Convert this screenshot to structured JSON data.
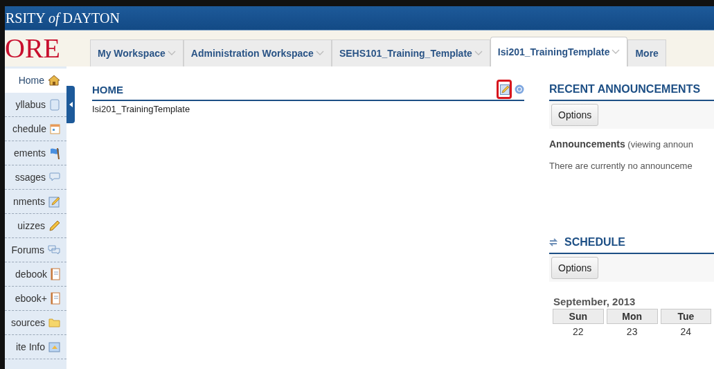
{
  "header": {
    "title": "RSITY *of* DAYTON",
    "logo": "ORE"
  },
  "tabs": [
    {
      "label": "My Workspace",
      "selected": false,
      "menu": true
    },
    {
      "label": "Administration Workspace",
      "selected": false,
      "menu": true
    },
    {
      "label": "SEHS101_Training_Template",
      "selected": false,
      "menu": true
    },
    {
      "label": "Isi201_TrainingTemplate",
      "selected": true,
      "menu": true
    },
    {
      "label": "More",
      "selected": false,
      "menu": false
    }
  ],
  "sidebar": {
    "items": [
      {
        "label": "Home",
        "kind": "home",
        "selected": true
      },
      {
        "label": "yllabus",
        "kind": "scroll",
        "selected": false
      },
      {
        "label": "chedule",
        "kind": "calendar",
        "selected": false
      },
      {
        "label": "ements",
        "kind": "flag",
        "selected": false
      },
      {
        "label": "ssages",
        "kind": "bubble",
        "selected": false
      },
      {
        "label": "nments",
        "kind": "edit",
        "selected": false
      },
      {
        "label": "uizzes",
        "kind": "pencil",
        "selected": false
      },
      {
        "label": "Forums",
        "kind": "bubbles",
        "selected": false
      },
      {
        "label": "debook",
        "kind": "notebook",
        "selected": false
      },
      {
        "label": "ebook+",
        "kind": "notebook",
        "selected": false
      },
      {
        "label": "sources",
        "kind": "folder",
        "selected": false
      },
      {
        "label": "ite Info",
        "kind": "info",
        "selected": false
      }
    ]
  },
  "home": {
    "title": "HOME",
    "site_name": "Isi201_TrainingTemplate",
    "edit_highlighted": true
  },
  "announcements": {
    "title": "RECENT ANNOUNCEMENTS",
    "options": "Options",
    "heading": "Announcements",
    "note": "(viewing announ",
    "empty": "There are currently no announceme"
  },
  "schedule": {
    "title": "SCHEDULE",
    "options": "Options",
    "month": "September, 2013",
    "days": [
      "Sun",
      "Mon",
      "Tue"
    ],
    "dates": [
      "22",
      "23",
      "24"
    ]
  }
}
